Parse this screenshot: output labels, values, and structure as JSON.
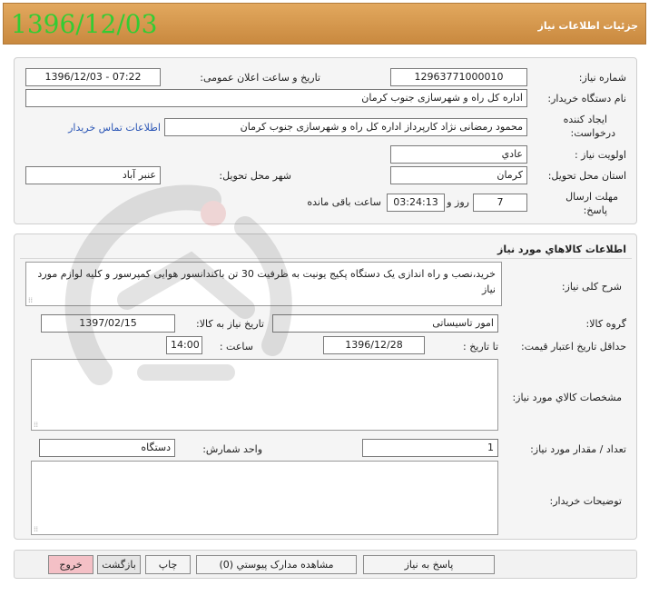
{
  "header": {
    "title": "جزئیات اطلاعات نیاز",
    "date_stamp": "1396/12/03"
  },
  "info": {
    "need_number_label": "شماره نیاز:",
    "need_number": "12963771000010",
    "announce_label": "تاریخ و ساعت اعلان عمومی:",
    "announce_value": "1396/12/03 - 07:22",
    "buyer_org_label": "نام دستگاه خریدار:",
    "buyer_org": "اداره کل راه و شهرسازی جنوب کرمان",
    "creator_label_1": "ایجاد کننده",
    "creator_label_2": "درخواست:",
    "creator": "محمود رمضانی نژاد کارپرداز اداره کل راه و شهرسازی جنوب کرمان",
    "contact_link": "اطلاعات تماس خریدار",
    "priority_label": "اولویت نیاز :",
    "priority": "عادي",
    "province_label": "استان محل تحویل:",
    "province": "کرمان",
    "city_label": "شهر محل تحویل:",
    "city": "عنبر آباد",
    "deadline_label_1": "مهلت ارسال",
    "deadline_label_2": "پاسخ:",
    "days_value": "7",
    "days_label": "روز و",
    "time_left": "03:24:13",
    "time_left_label": "ساعت باقی مانده"
  },
  "goods": {
    "section_title": "اطلاعات کالاهاي مورد نياز",
    "summary_label": "شرح کلی نیاز:",
    "summary": "خرید،نصب و راه اندازی یک دستگاه پکیج یونیت به ظرفیت 30 تن باکندانسور هوایی کمپرسور و کلیه لوازم مورد نیاز",
    "group_label": "گروه کالا:",
    "group": "امور تاسیساتی",
    "need_date_label": "تاریخ نیاز به کالا:",
    "need_date": "1397/02/15",
    "min_validity_label": "حداقل تاریخ اعتبار قیمت:",
    "until_date_label": "تا تاریخ :",
    "until_date": "1396/12/28",
    "time_label": "ساعت :",
    "time": "14:00",
    "specs_label": "مشخصات کالاي مورد نياز:",
    "qty_label": "تعداد / مقدار مورد نیاز:",
    "qty": "1",
    "unit_label": "واحد شمارش:",
    "unit": "دستگاه",
    "buyer_notes_label": "توضیحات خریدار:"
  },
  "buttons": {
    "reply": "پاسخ به نیاز",
    "attachments": "مشاهده مدارک پیوستي (0)",
    "print": "چاپ",
    "back": "بازگشت",
    "exit": "خروج"
  }
}
